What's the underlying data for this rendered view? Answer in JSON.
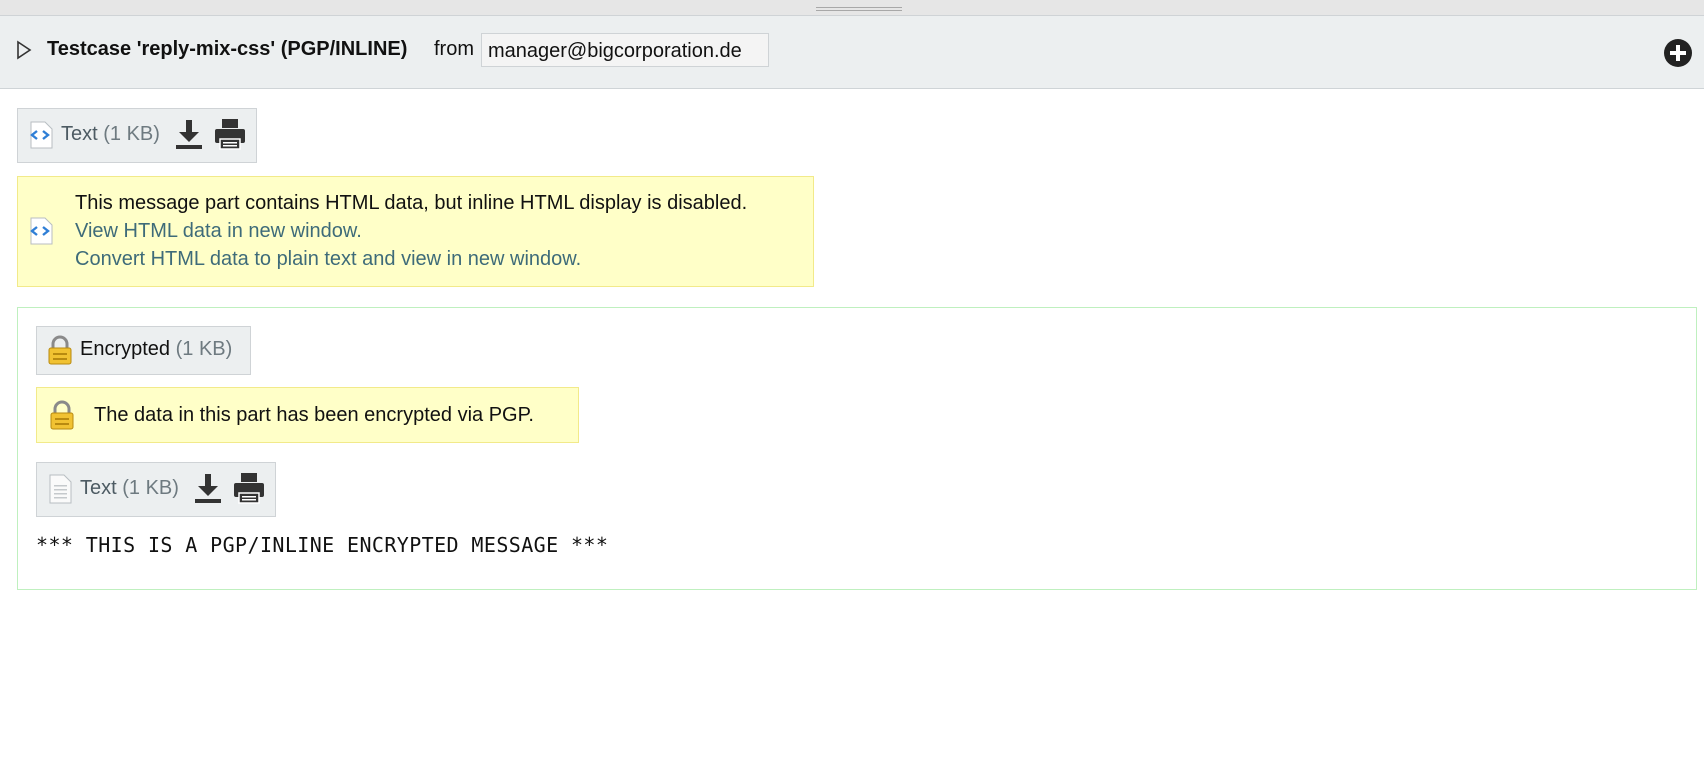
{
  "header": {
    "subject": "Testcase 'reply-mix-css' (PGP/INLINE)",
    "from_label": "from",
    "sender": "manager@bigcorporation.de"
  },
  "html_part": {
    "label": "Text",
    "size": "(1 KB)",
    "icons": [
      "html-file-icon",
      "download-icon",
      "print-icon"
    ]
  },
  "html_notice": {
    "message": "This message part contains HTML data, but inline HTML display is disabled.",
    "view_link": "View HTML data in new window.",
    "convert_link": "Convert HTML data to plain text and view in new window."
  },
  "encrypted_part": {
    "label": "Encrypted",
    "size": "(1 KB)",
    "notice": "The data in this part has been encrypted via PGP."
  },
  "text_part": {
    "label": "Text",
    "size": "(1 KB)",
    "icons": [
      "text-file-icon",
      "download-icon",
      "print-icon"
    ]
  },
  "body_text": "*** THIS IS A PGP/INLINE ENCRYPTED MESSAGE ***",
  "colors": {
    "header_bg": "#eceff0",
    "notice_bg": "#ffffc8",
    "link": "#3e6b79",
    "encrypted_border": "#bff0bf"
  }
}
